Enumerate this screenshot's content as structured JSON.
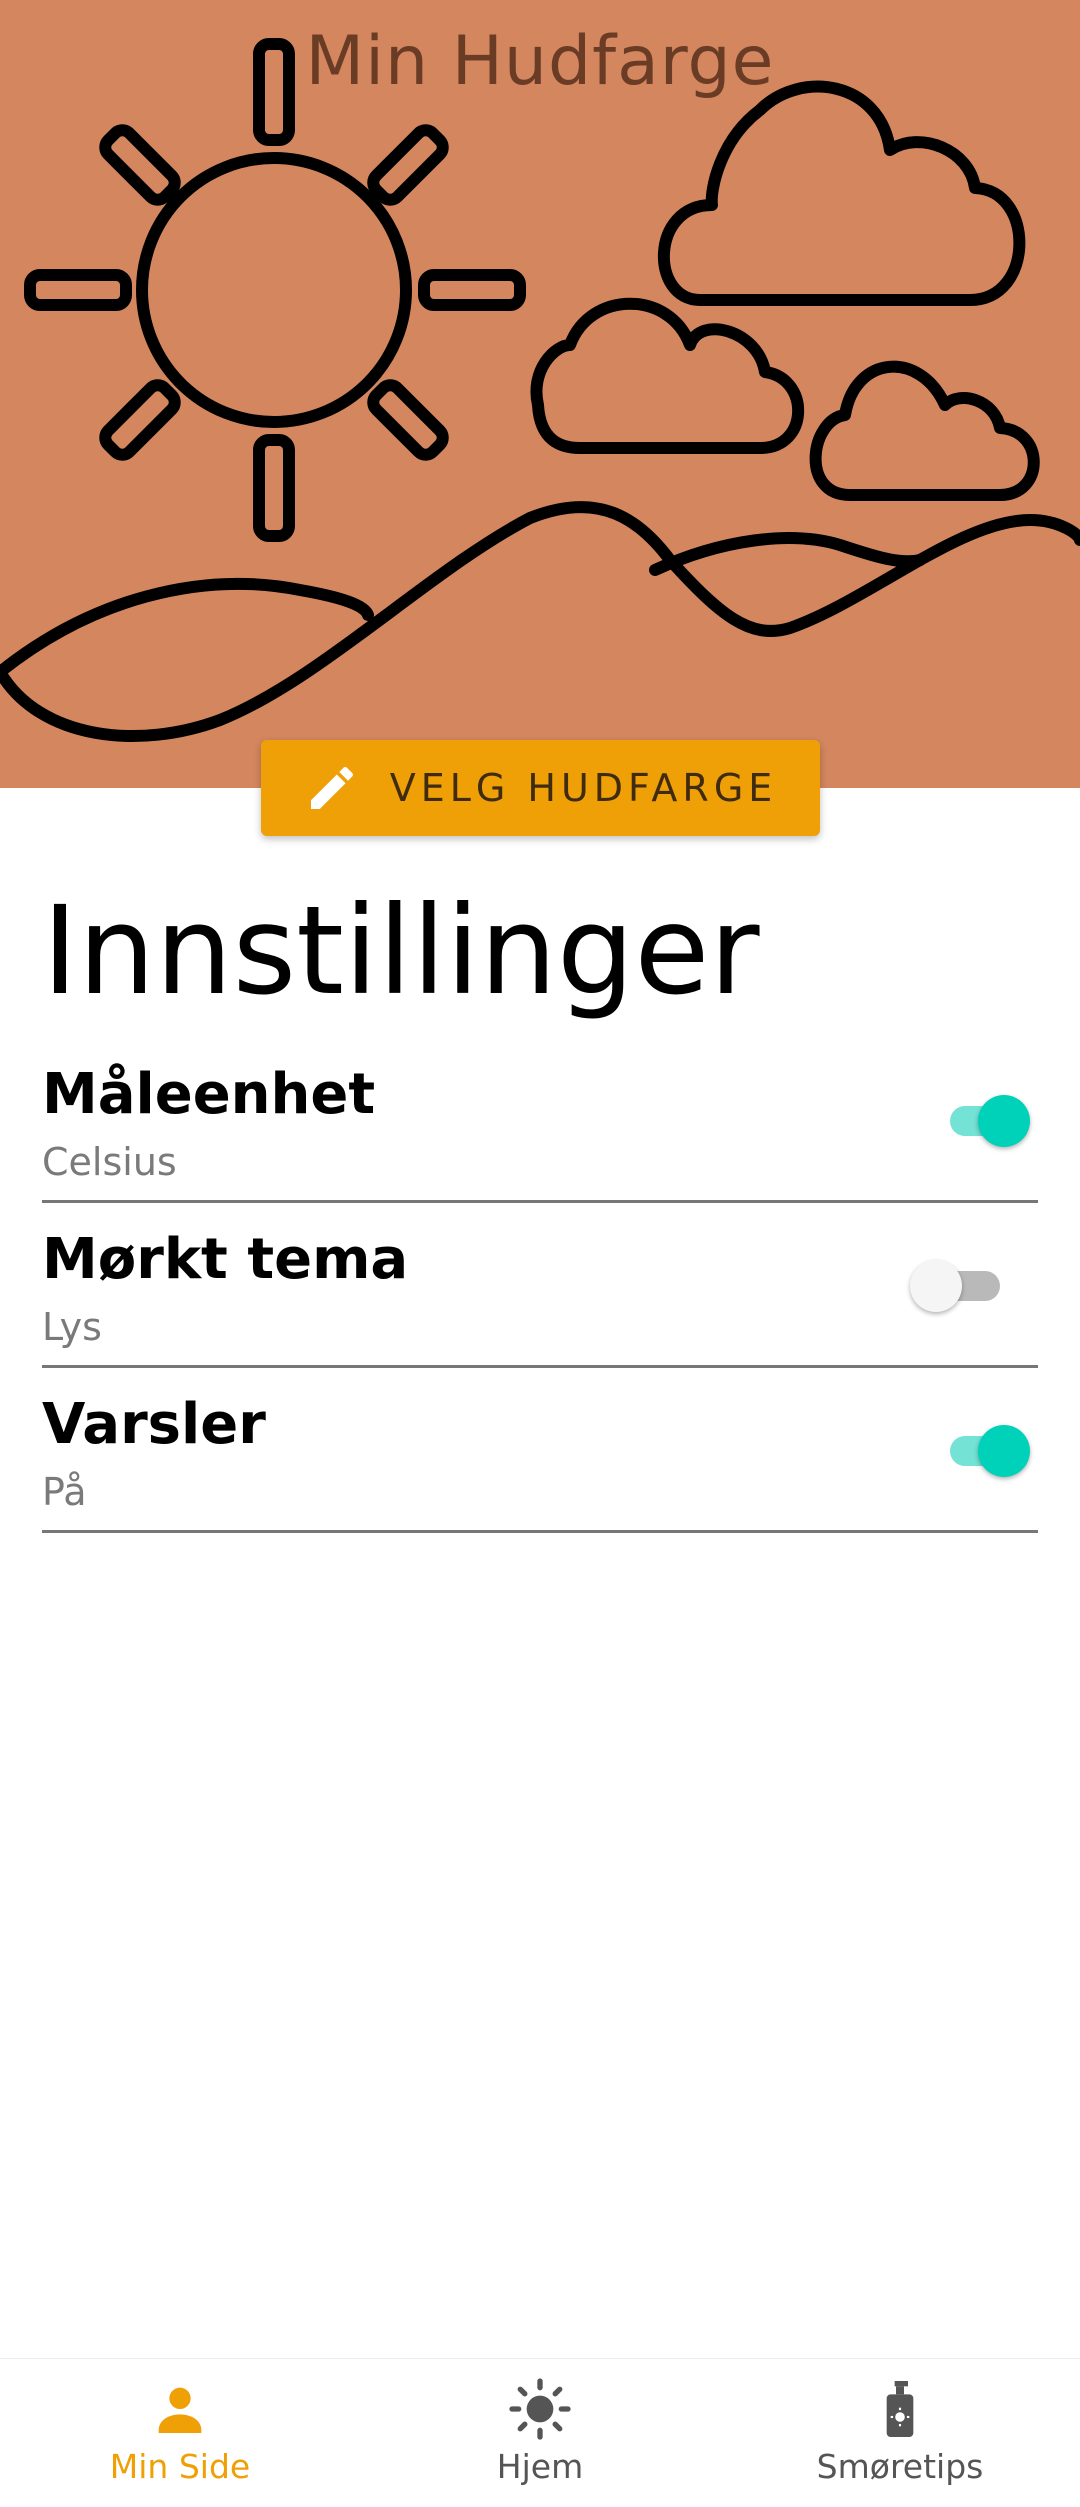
{
  "hero": {
    "title": "Min Hudfarge",
    "background": "#d4875f",
    "choose_button_label": "VELG HUDFARGE",
    "choose_button_icon": "pencil-icon"
  },
  "settings": {
    "title": "Innstillinger",
    "items": [
      {
        "label": "Måleenhet",
        "value": "Celsius",
        "enabled": true
      },
      {
        "label": "Mørkt tema",
        "value": "Lys",
        "enabled": false
      },
      {
        "label": "Varsler",
        "value": "På",
        "enabled": true
      }
    ]
  },
  "nav": {
    "items": [
      {
        "label": "Min Side",
        "icon": "person-icon",
        "active": true
      },
      {
        "label": "Hjem",
        "icon": "sun-icon",
        "active": false
      },
      {
        "label": "Smøretips",
        "icon": "sunscreen-bottle-icon",
        "active": false
      }
    ]
  },
  "colors": {
    "accent": "#f0a007",
    "toggle_on": "#00d1b9",
    "hero_bg": "#d4875f"
  }
}
